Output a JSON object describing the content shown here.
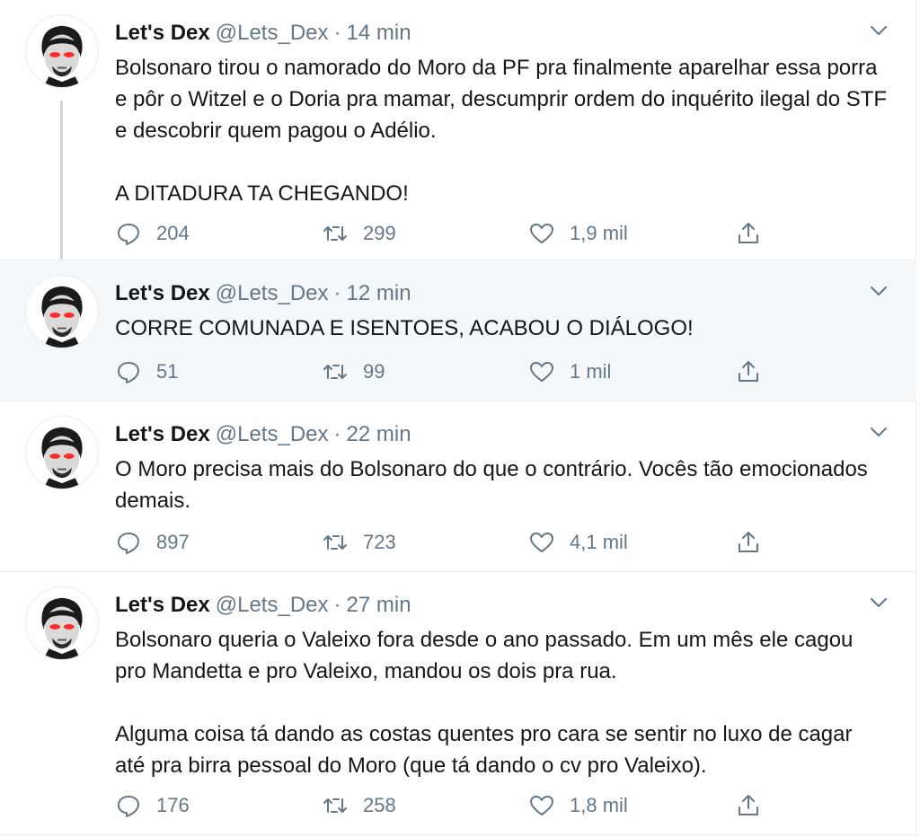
{
  "tweets": [
    {
      "name": "Let's Dex",
      "handle": "@Lets_Dex",
      "separator": "·",
      "time": "14 min",
      "paragraphs": [
        "Bolsonaro tirou o namorado do Moro da PF pra finalmente aparelhar essa porra e pôr o Witzel e o Doria pra mamar, descumprir ordem do inquérito ilegal do STF e descobrir quem pagou o Adélio.",
        "A DITADURA TA CHEGANDO!"
      ],
      "replies": "204",
      "retweets": "299",
      "likes": "1,9 mil"
    },
    {
      "name": "Let's Dex",
      "handle": "@Lets_Dex",
      "separator": "·",
      "time": "12 min",
      "paragraphs": [
        "CORRE COMUNADA E ISENTOES, ACABOU O DIÁLOGO!"
      ],
      "replies": "51",
      "retweets": "99",
      "likes": "1 mil"
    },
    {
      "name": "Let's Dex",
      "handle": "@Lets_Dex",
      "separator": "·",
      "time": "22 min",
      "paragraphs": [
        "O Moro precisa mais do Bolsonaro do que o contrário. Vocês tão emocionados demais."
      ],
      "replies": "897",
      "retweets": "723",
      "likes": "4,1 mil"
    },
    {
      "name": "Let's Dex",
      "handle": "@Lets_Dex",
      "separator": "·",
      "time": "27 min",
      "paragraphs": [
        "Bolsonaro queria o Valeixo fora desde o ano passado. Em um mês ele cagou pro Mandetta e pro Valeixo, mandou os dois pra rua.",
        "Alguma coisa tá dando as costas quentes pro cara se sentir no luxo de cagar até pra birra pessoal do Moro (que tá dando o cv pro Valeixo)."
      ],
      "replies": "176",
      "retweets": "258",
      "likes": "1,8 mil"
    }
  ],
  "icons": {
    "reply": "reply-icon",
    "retweet": "retweet-icon",
    "like": "heart-icon",
    "share": "share-icon",
    "caret": "chevron-down-icon",
    "avatar": "avatar"
  },
  "colors": {
    "text": "#14171a",
    "secondary": "#657786",
    "highlight_bg": "#f5f8fa",
    "border": "#e6ecf0",
    "thread_line": "#ccd6dd",
    "eye_glow": "#ff2a2a"
  }
}
